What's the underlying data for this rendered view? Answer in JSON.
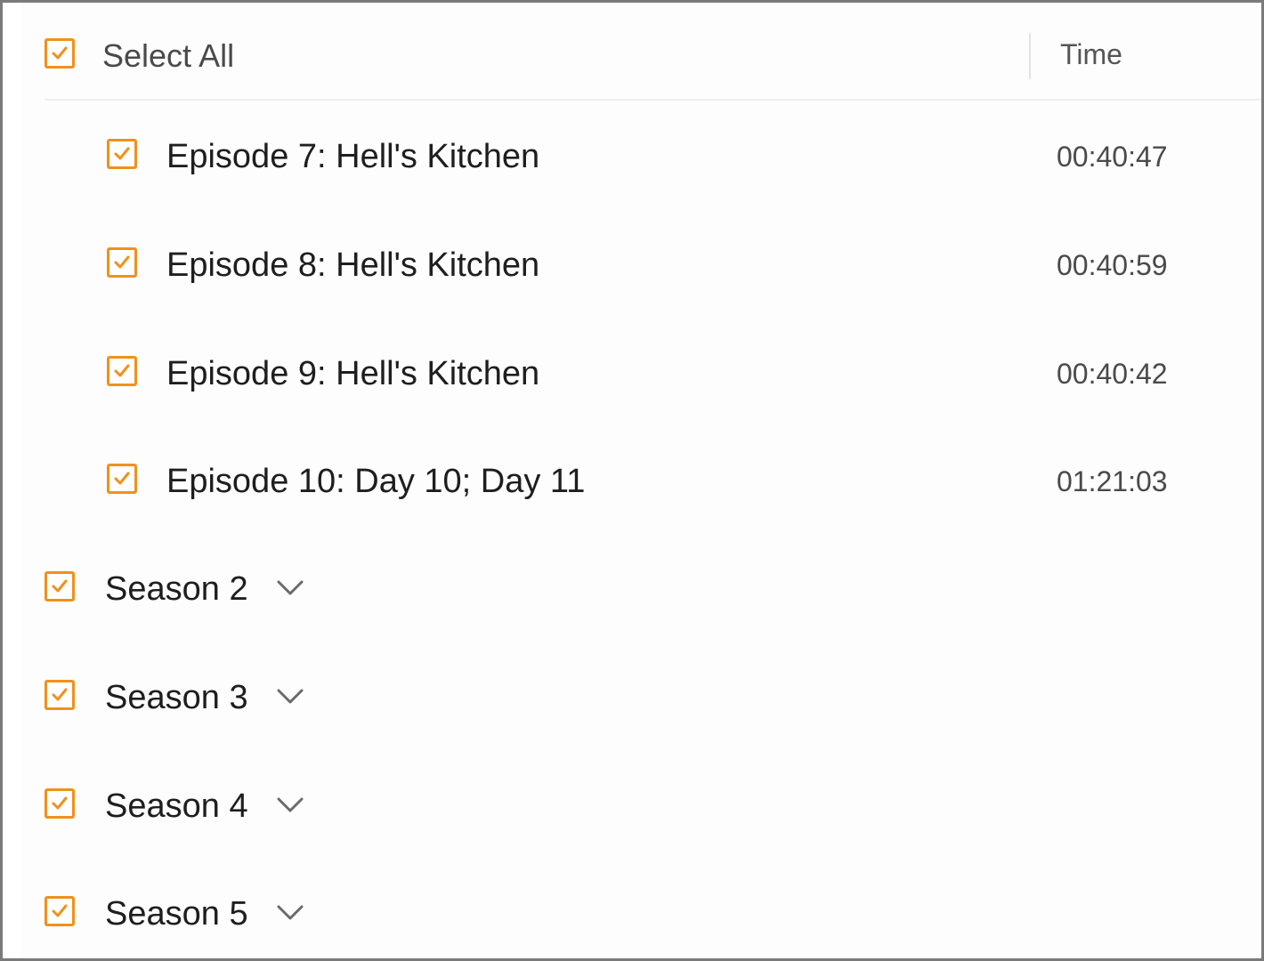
{
  "header": {
    "select_all_label": "Select All",
    "time_column_label": "Time"
  },
  "episodes": [
    {
      "label": "Episode 7: Hell's Kitchen",
      "time": "00:40:47",
      "checked": true
    },
    {
      "label": "Episode 8: Hell's Kitchen",
      "time": "00:40:59",
      "checked": true
    },
    {
      "label": "Episode 9: Hell's Kitchen",
      "time": "00:40:42",
      "checked": true
    },
    {
      "label": "Episode 10: Day 10; Day 11",
      "time": "01:21:03",
      "checked": true
    }
  ],
  "seasons": [
    {
      "label": "Season 2",
      "checked": true
    },
    {
      "label": "Season 3",
      "checked": true
    },
    {
      "label": "Season 4",
      "checked": true
    },
    {
      "label": "Season 5",
      "checked": true
    }
  ],
  "colors": {
    "accent": "#f0911b",
    "text": "#1e1e1e",
    "muted_text": "#4a4a4a"
  },
  "icons": {
    "checkbox": "checkbox-checked-icon",
    "expand": "chevron-down-icon"
  }
}
